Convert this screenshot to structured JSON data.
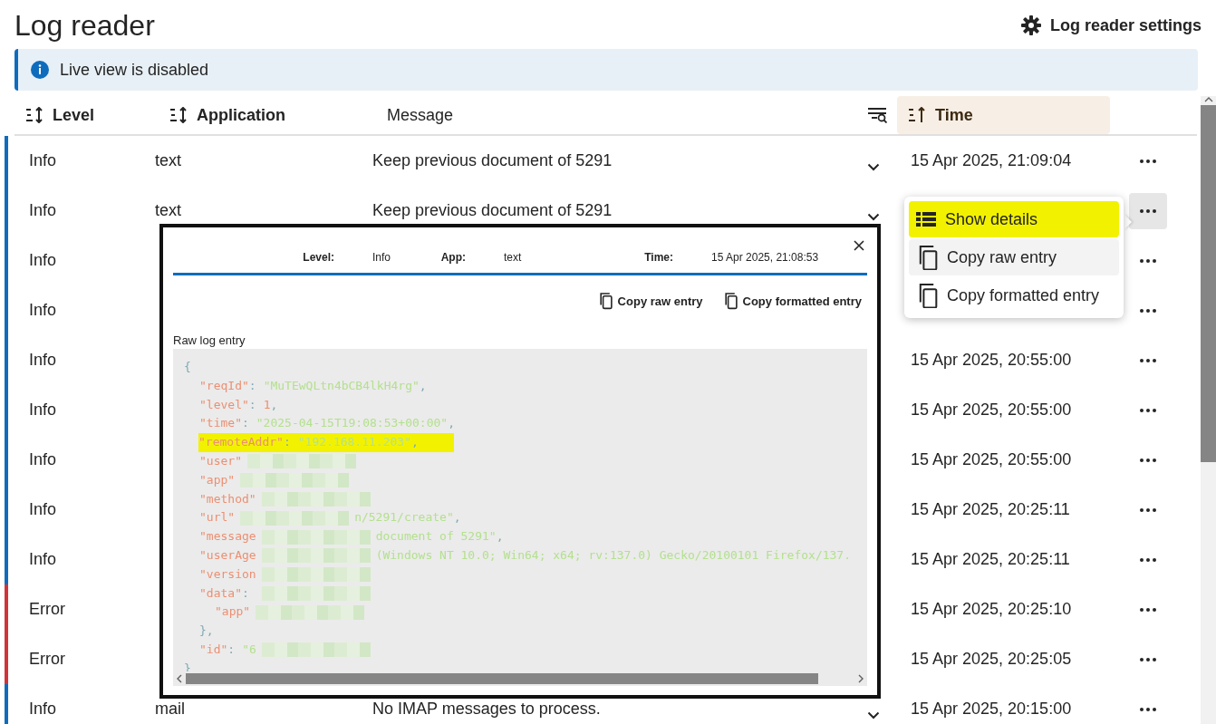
{
  "title": "Log reader",
  "settings_button": {
    "label": "Log reader settings"
  },
  "banner": {
    "text": "Live view is disabled"
  },
  "columns": [
    {
      "label": "Level",
      "sortable": true,
      "sorted": false,
      "bold": true
    },
    {
      "label": "Application",
      "sortable": true,
      "sorted": false,
      "bold": true
    },
    {
      "label": "Message",
      "sortable": false,
      "sorted": false,
      "bold": false
    },
    {
      "label": "Time",
      "sortable": true,
      "sorted": true,
      "bold": true
    }
  ],
  "rows": [
    {
      "level": "Info",
      "color": "#0f6cbd",
      "application": "text",
      "message": "Keep previous document of 5291",
      "time": "15 Apr 2025, 21:09:04",
      "expandable": true,
      "menu_open": false
    },
    {
      "level": "Info",
      "color": "#0f6cbd",
      "application": "text",
      "message": "Keep previous document of 5291",
      "expandable": true,
      "menu_open": true
    },
    {
      "level": "Info",
      "color": "#0f6cbd",
      "menu_open": false
    },
    {
      "level": "Info",
      "color": "#0f6cbd",
      "menu_open": false
    },
    {
      "level": "Info",
      "color": "#0f6cbd",
      "time": "15 Apr 2025, 20:55:00",
      "menu_open": false
    },
    {
      "level": "Info",
      "color": "#0f6cbd",
      "time": "15 Apr 2025, 20:55:00",
      "menu_open": false
    },
    {
      "level": "Info",
      "color": "#0f6cbd",
      "time": "15 Apr 2025, 20:55:00",
      "menu_open": false
    },
    {
      "level": "Info",
      "color": "#0f6cbd",
      "time": "15 Apr 2025, 20:25:11",
      "menu_open": false
    },
    {
      "level": "Info",
      "color": "#0f6cbd",
      "time": "15 Apr 2025, 20:25:11",
      "menu_open": false
    },
    {
      "level": "Error",
      "color": "#d13438",
      "time": "15 Apr 2025, 20:25:10",
      "menu_open": false
    },
    {
      "level": "Error",
      "color": "#d13438",
      "time": "15 Apr 2025, 20:25:05",
      "menu_open": false
    },
    {
      "level": "Info",
      "color": "#0f6cbd",
      "application": "mail",
      "message": "No IMAP messages to process.",
      "time": "15 Apr 2025, 20:15:00",
      "expandable": true,
      "menu_open": false
    }
  ],
  "menu": {
    "items": [
      {
        "label": "Show details",
        "highlighted": true,
        "hovered": false
      },
      {
        "label": "Copy raw entry",
        "highlighted": false,
        "hovered": true
      },
      {
        "label": "Copy formatted entry",
        "highlighted": false,
        "hovered": false
      }
    ]
  },
  "dialog": {
    "fields": [
      {
        "label": "Level:",
        "value": "Info"
      },
      {
        "label": "App:",
        "value": "text"
      },
      {
        "label": "Time:",
        "value": "15 Apr 2025, 21:08:53"
      }
    ],
    "buttons": [
      "Copy raw entry",
      "Copy formatted entry"
    ],
    "section_label": "Raw log entry",
    "code": {
      "open": "{",
      "close": "}",
      "lines": [
        {
          "highlighted": false,
          "parts": [
            {
              "kind": "key",
              "text": "\"reqId\""
            },
            {
              "kind": "sep",
              "text": ":"
            },
            {
              "kind": "string",
              "text": "\"MuTEwQLtn4bCB4lkH4rg\""
            },
            {
              "kind": "punct",
              "text": ","
            }
          ]
        },
        {
          "highlighted": false,
          "parts": [
            {
              "kind": "key",
              "text": "\"level\""
            },
            {
              "kind": "sep",
              "text": ":"
            },
            {
              "kind": "number",
              "text": "1"
            },
            {
              "kind": "punct",
              "text": ","
            }
          ]
        },
        {
          "highlighted": false,
          "parts": [
            {
              "kind": "key",
              "text": "\"time\""
            },
            {
              "kind": "sep",
              "text": ":"
            },
            {
              "kind": "string",
              "text": "\"2025-04-15T19:08:53+00:00\""
            },
            {
              "kind": "punct",
              "text": ","
            }
          ]
        },
        {
          "highlighted": true,
          "parts": [
            {
              "kind": "key",
              "text": "\"remoteAddr\""
            },
            {
              "kind": "sep",
              "text": ":"
            },
            {
              "kind": "string",
              "text": "\"192.168.11.203\""
            },
            {
              "kind": "punct",
              "text": ","
            }
          ]
        },
        {
          "highlighted": false,
          "parts": [
            {
              "kind": "key",
              "text": "\"user\""
            },
            {
              "kind": "redacted"
            }
          ]
        },
        {
          "highlighted": false,
          "parts": [
            {
              "kind": "key",
              "text": "\"app\""
            },
            {
              "kind": "redacted"
            }
          ]
        },
        {
          "highlighted": false,
          "parts": [
            {
              "kind": "key",
              "text": "\"method\""
            },
            {
              "kind": "redacted"
            }
          ]
        },
        {
          "highlighted": false,
          "parts": [
            {
              "kind": "key",
              "text": "\"url\""
            },
            {
              "kind": "redacted"
            },
            {
              "kind": "string",
              "text": "n/5291/create\""
            },
            {
              "kind": "punct",
              "text": ","
            }
          ]
        },
        {
          "highlighted": false,
          "parts": [
            {
              "kind": "key",
              "text": "\"message"
            },
            {
              "kind": "redacted"
            },
            {
              "kind": "string",
              "text": "document of 5291\""
            },
            {
              "kind": "punct",
              "text": ","
            }
          ]
        },
        {
          "highlighted": false,
          "parts": [
            {
              "kind": "key",
              "text": "\"userAge"
            },
            {
              "kind": "redacted"
            },
            {
              "kind": "string",
              "text": "(Windows NT 10.0; Win64; x64; rv:137.0) Gecko/20100101 Firefox/137."
            }
          ]
        },
        {
          "highlighted": false,
          "parts": [
            {
              "kind": "key",
              "text": "\"version"
            },
            {
              "kind": "redacted"
            }
          ]
        },
        {
          "highlighted": false,
          "parts": [
            {
              "kind": "key",
              "text": "\"data\""
            },
            {
              "kind": "sep",
              "text": ":"
            },
            {
              "kind": "redacted"
            }
          ],
          "close": "},",
          "children": [
            {
              "highlighted": false,
              "parts": [
                {
                  "kind": "key",
                  "text": "\"app\""
                },
                {
                  "kind": "redacted"
                }
              ]
            }
          ]
        },
        {
          "highlighted": false,
          "parts": [
            {
              "kind": "key",
              "text": "\"id\""
            },
            {
              "kind": "sep",
              "text": ":"
            },
            {
              "kind": "string",
              "text": "\"6"
            },
            {
              "kind": "redacted"
            }
          ]
        }
      ]
    }
  }
}
